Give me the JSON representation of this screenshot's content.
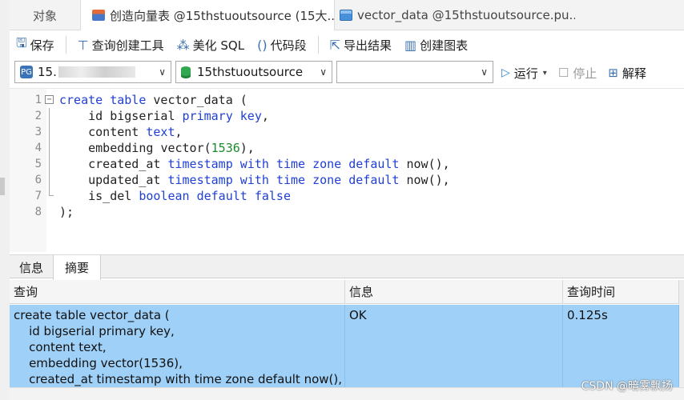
{
  "tabs": [
    {
      "label": "对象"
    },
    {
      "label": "创造向量表 @15thstuoutsource (15大..."
    },
    {
      "label": "vector_data @15thstuoutsource.pu..."
    }
  ],
  "toolbar": {
    "save": "保存",
    "query_builder": "查询创建工具",
    "beautify": "美化 SQL",
    "snippet": "代码段",
    "export": "导出结果",
    "chart": "创建图表"
  },
  "connection": {
    "server_prefix": "15.",
    "database": "15thstuoutsource",
    "schema": ""
  },
  "run": {
    "run": "运行",
    "stop": "停止",
    "explain": "解释"
  },
  "editor": {
    "lines": [
      {
        "n": "1",
        "t": [
          "create table vector_data ("
        ]
      },
      {
        "n": "2",
        "t": [
          "    id bigserial primary key,"
        ]
      },
      {
        "n": "3",
        "t": [
          "    content text,"
        ]
      },
      {
        "n": "4",
        "t": [
          "    embedding vector(1536),"
        ]
      },
      {
        "n": "5",
        "t": [
          "    created_at timestamp with time zone default now(),"
        ]
      },
      {
        "n": "6",
        "t": [
          "    updated_at timestamp with time zone default now(),"
        ]
      },
      {
        "n": "7",
        "t": [
          "    is_del boolean default false"
        ]
      },
      {
        "n": "8",
        "t": [
          ");"
        ]
      }
    ]
  },
  "result": {
    "tab_info": "信息",
    "tab_summary": "摘要",
    "headers": {
      "query": "查询",
      "message": "信息",
      "time": "查询时间"
    },
    "row": {
      "query": "create table vector_data (\n    id bigserial primary key,\n    content text,\n    embedding vector(1536),\n    created_at timestamp with time zone default now(),",
      "message": "OK",
      "time": "0.125s"
    }
  },
  "watermark": "CSDN @暗雾飘扬",
  "colors": {
    "keyword": "#1f3fd6",
    "number": "#1a8a2a",
    "selected_row": "#9fd0f7"
  }
}
